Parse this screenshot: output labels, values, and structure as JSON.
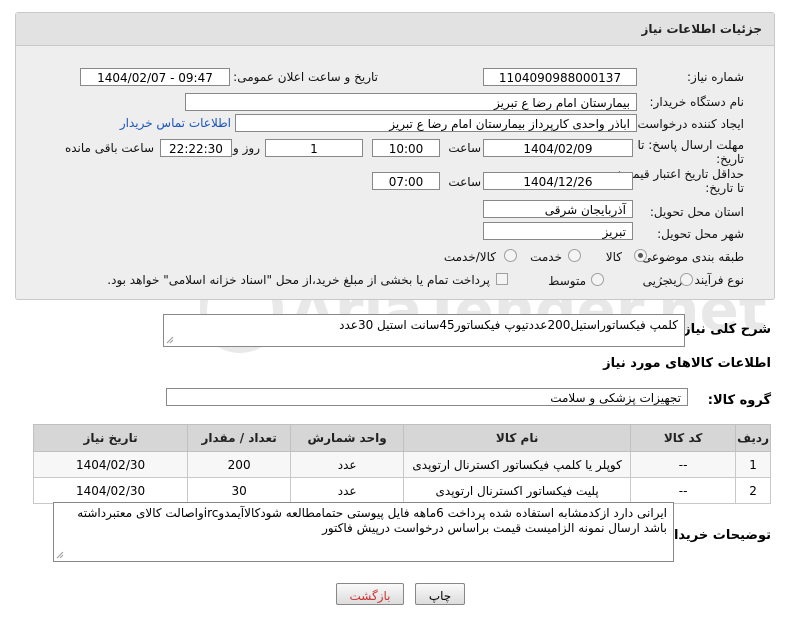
{
  "panel": {
    "title": "جزئیات اطلاعات نیاز"
  },
  "fields": {
    "need_number_label": "شماره نیاز:",
    "need_number": "1104090988000137",
    "announce_label": "تاریخ و ساعت اعلان عمومی:",
    "announce_value": "1404/02/07 - 09:47",
    "buyer_label": "نام دستگاه خریدار:",
    "buyer_value": "بیمارستان امام رضا  ع  تبریز",
    "creator_label": "ایجاد کننده درخواست:",
    "creator_value": "اباذر واحدی کارپرداز بیمارستان امام رضا  ع  تبریز",
    "contact_link": "اطلاعات تماس خریدار",
    "deadline_label_1": "مهلت ارسال پاسخ: تا",
    "deadline_label_2": "تاریخ:",
    "deadline_date": "1404/02/09",
    "time_word": "ساعت",
    "deadline_time": "10:00",
    "days_value": "1",
    "days_word": "روز و",
    "remaining_value": "22:22:30",
    "remaining_word": "ساعت باقی مانده",
    "validity_label_1": "حداقل تاریخ اعتبار قیمت:",
    "validity_label_2": "تا تاریخ:",
    "validity_date": "1404/12/26",
    "validity_time_word": "ساعت",
    "validity_time": "07:00",
    "province_label": "استان محل تحویل:",
    "province_value": "آذربایجان شرقی",
    "city_label": "شهر محل تحویل:",
    "city_value": "تبریز",
    "category_label": "طبقه بندی موضوعی:",
    "category_options": [
      "کالا",
      "خدمت",
      "کالا/خدمت"
    ],
    "process_label": "نوع فرآیند خرید :",
    "process_options": [
      "جزیی",
      "متوسط"
    ],
    "payment_note": "پرداخت تمام یا بخشی از مبلغ خرید،از محل \"اسناد خزانه اسلامی\" خواهد بود."
  },
  "description": {
    "label": "شرح کلی نیاز:",
    "value": "کلمپ فیکساتوراستیل200عددتیوپ فیکساتور45سانت استیل 30عدد"
  },
  "goods": {
    "section_title": "اطلاعات کالاهای مورد نیاز",
    "group_label": "گروه کالا:",
    "group_value": "تجهیزات پزشکی و سلامت",
    "columns": [
      "ردیف",
      "کد کالا",
      "نام کالا",
      "واحد شمارش",
      "تعداد / مقدار",
      "تاریخ نیاز"
    ],
    "rows": [
      {
        "row": "1",
        "code": "--",
        "name": "کوپلر یا کلمپ فیکساتور اکسترنال ارتوپدی",
        "unit": "عدد",
        "qty": "200",
        "date": "1404/02/30"
      },
      {
        "row": "2",
        "code": "--",
        "name": "پلیت فیکساتور اکسترنال ارتوپدی",
        "unit": "عدد",
        "qty": "30",
        "date": "1404/02/30"
      }
    ]
  },
  "buyer_notes": {
    "label": "توضیحات خریدار:",
    "value": "ایرانی دارد ازکدمشابه استفاده شده پرداخت 6ماهه فایل پیوستی حتمامطالعه شودکالاآیمدوircواصالت کالای معتبرداشته باشد ارسال نمونه الزامیست قیمت براساس درخواست درپیش فاکتور"
  },
  "buttons": {
    "print": "چاپ",
    "back": "بازگشت"
  },
  "colors": {
    "link": "#1a56b8",
    "back_text": "#cc3333"
  },
  "watermark": "AriaTender.net"
}
